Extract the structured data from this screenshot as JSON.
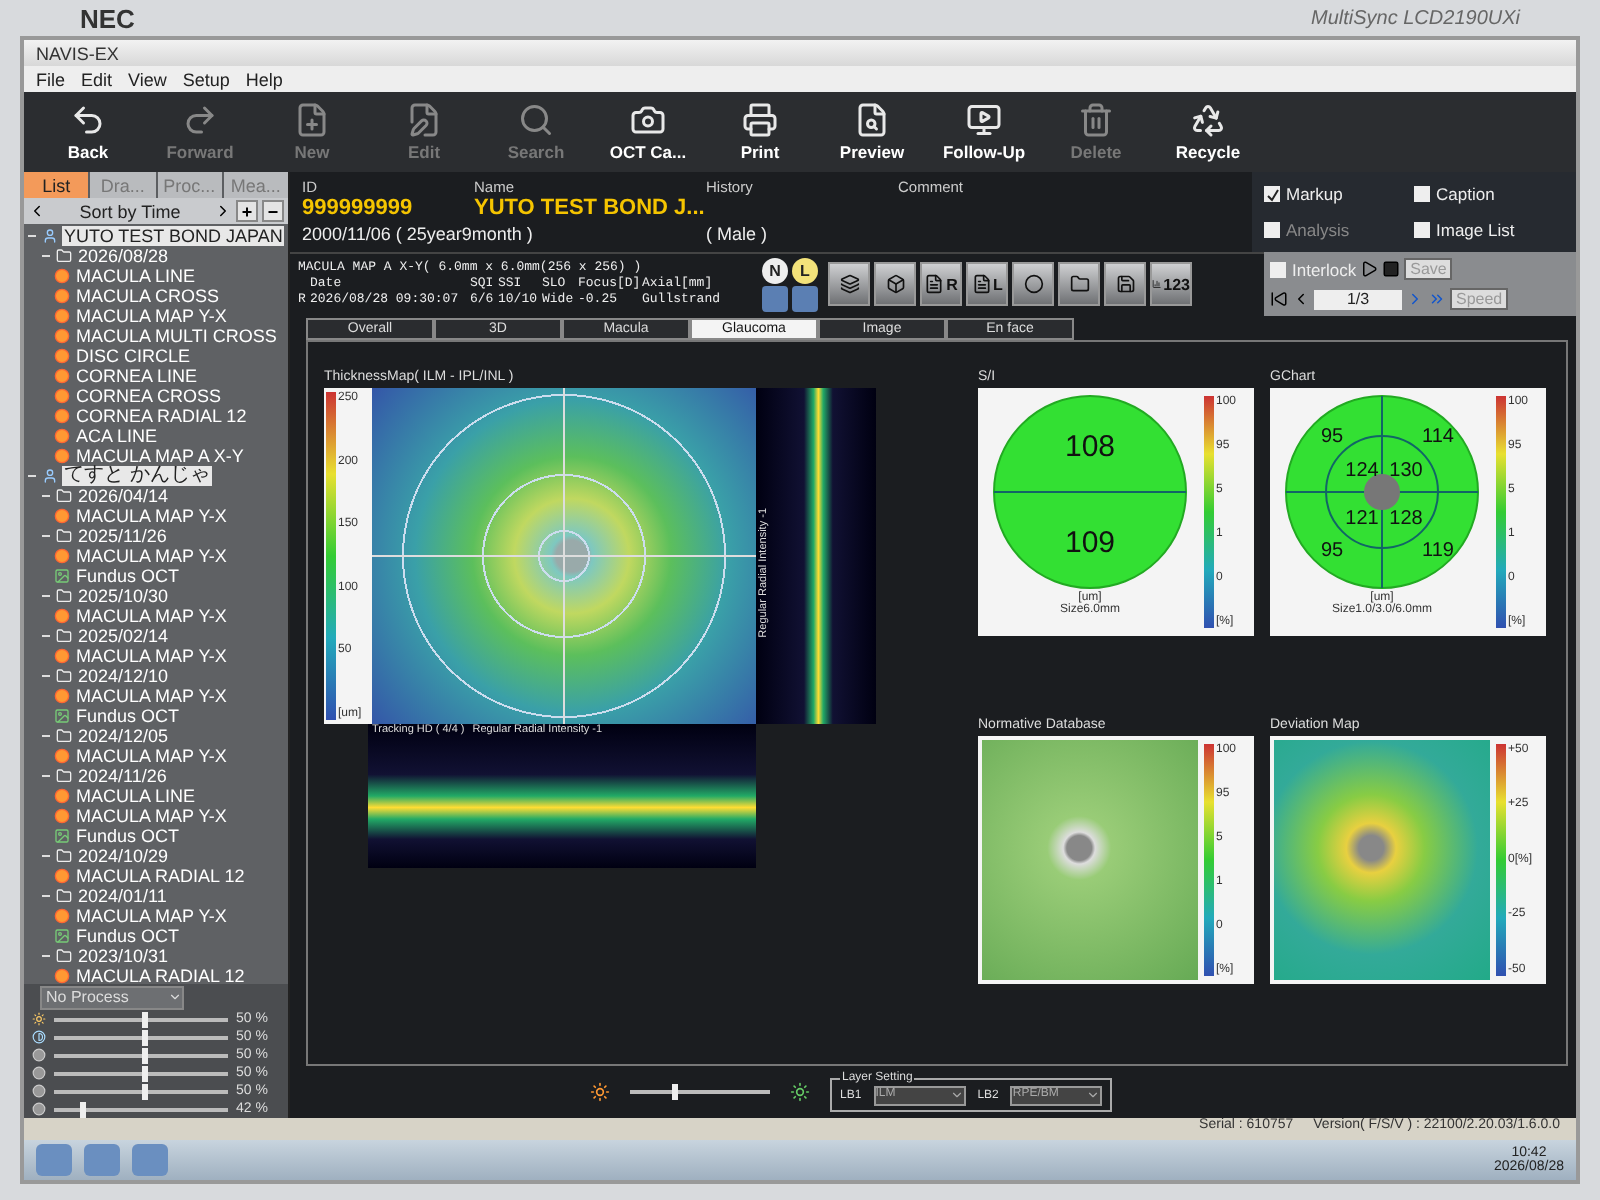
{
  "monitor": {
    "brand": "NEC",
    "model": "MultiSync LCD2190UXi"
  },
  "window": {
    "title": "NAVIS-EX"
  },
  "menu": [
    "File",
    "Edit",
    "View",
    "Setup",
    "Help"
  ],
  "toolbar": [
    {
      "label": "Back",
      "disabled": false
    },
    {
      "label": "Forward",
      "disabled": true
    },
    {
      "label": "New",
      "disabled": true
    },
    {
      "label": "Edit",
      "disabled": true
    },
    {
      "label": "Search",
      "disabled": true
    },
    {
      "label": "OCT Ca...",
      "disabled": false
    },
    {
      "label": "Print",
      "disabled": false
    },
    {
      "label": "Preview",
      "disabled": false
    },
    {
      "label": "Follow-Up",
      "disabled": false
    },
    {
      "label": "Delete",
      "disabled": true
    },
    {
      "label": "Recycle",
      "disabled": false
    }
  ],
  "view_options": [
    {
      "label": "Markup",
      "checked": true,
      "disabled": false
    },
    {
      "label": "Caption",
      "checked": false,
      "disabled": false
    },
    {
      "label": "Analysis",
      "checked": false,
      "disabled": true
    },
    {
      "label": "Image List",
      "checked": false,
      "disabled": false
    }
  ],
  "sidebar": {
    "tabs": [
      {
        "label": "List",
        "selected": true
      },
      {
        "label": "Dra...",
        "selected": false
      },
      {
        "label": "Proc...",
        "selected": false
      },
      {
        "label": "Mea...",
        "selected": false
      }
    ],
    "sort": "Sort by Time",
    "add": "+",
    "remove": "−",
    "tree": [
      {
        "label": "YUTO TEST BOND JAPAN",
        "kind": "patient",
        "children": [
          {
            "label": "2026/08/28",
            "kind": "date",
            "children": [
              {
                "label": "MACULA LINE",
                "kind": "scan"
              },
              {
                "label": "MACULA CROSS",
                "kind": "scan"
              },
              {
                "label": "MACULA MAP Y-X",
                "kind": "scan"
              },
              {
                "label": "MACULA MULTI CROSS",
                "kind": "scan"
              },
              {
                "label": "DISC CIRCLE",
                "kind": "scan"
              },
              {
                "label": "CORNEA LINE",
                "kind": "scan"
              },
              {
                "label": "CORNEA CROSS",
                "kind": "scan"
              },
              {
                "label": "CORNEA RADIAL 12",
                "kind": "scan"
              },
              {
                "label": "ACA LINE",
                "kind": "scan"
              },
              {
                "label": "MACULA MAP A X-Y",
                "kind": "scan"
              }
            ]
          }
        ]
      },
      {
        "label": "てすと かんじゃ",
        "kind": "patient",
        "children": [
          {
            "label": "2026/04/14",
            "kind": "date",
            "children": [
              {
                "label": "MACULA MAP Y-X",
                "kind": "scan"
              }
            ]
          },
          {
            "label": "2025/11/26",
            "kind": "date",
            "children": [
              {
                "label": "MACULA MAP Y-X",
                "kind": "scan"
              },
              {
                "label": "Fundus OCT",
                "kind": "fundus"
              }
            ]
          },
          {
            "label": "2025/10/30",
            "kind": "date",
            "children": [
              {
                "label": "MACULA MAP Y-X",
                "kind": "scan"
              }
            ]
          },
          {
            "label": "2025/02/14",
            "kind": "date",
            "children": [
              {
                "label": "MACULA MAP Y-X",
                "kind": "scan"
              }
            ]
          },
          {
            "label": "2024/12/10",
            "kind": "date",
            "children": [
              {
                "label": "MACULA MAP Y-X",
                "kind": "scan"
              },
              {
                "label": "Fundus OCT",
                "kind": "fundus"
              }
            ]
          },
          {
            "label": "2024/12/05",
            "kind": "date",
            "children": [
              {
                "label": "MACULA MAP Y-X",
                "kind": "scan"
              }
            ]
          },
          {
            "label": "2024/11/26",
            "kind": "date",
            "children": [
              {
                "label": "MACULA LINE",
                "kind": "scan"
              },
              {
                "label": "MACULA MAP Y-X",
                "kind": "scan"
              },
              {
                "label": "Fundus OCT",
                "kind": "fundus"
              }
            ]
          },
          {
            "label": "2024/10/29",
            "kind": "date",
            "children": [
              {
                "label": "MACULA RADIAL 12",
                "kind": "scan"
              }
            ]
          },
          {
            "label": "2024/01/11",
            "kind": "date",
            "children": [
              {
                "label": "MACULA MAP Y-X",
                "kind": "scan"
              },
              {
                "label": "Fundus OCT",
                "kind": "fundus"
              }
            ]
          },
          {
            "label": "2023/10/31",
            "kind": "date",
            "children": [
              {
                "label": "MACULA RADIAL 12",
                "kind": "scan"
              }
            ]
          }
        ]
      }
    ],
    "process": "No Process",
    "adjusters": [
      {
        "level": 0.5,
        "reading": "50 %"
      },
      {
        "level": 0.5,
        "reading": "50 %"
      },
      {
        "level": 0.5,
        "reading": "50 %"
      },
      {
        "level": 0.5,
        "reading": "50 %"
      },
      {
        "level": 0.5,
        "reading": "50 %"
      },
      {
        "level": 0.15,
        "reading": "42 %"
      }
    ]
  },
  "patient": {
    "id_label": "ID",
    "id": "999999999",
    "name_label": "Name",
    "name": "YUTO TEST BOND J...",
    "history_label": "History",
    "comment_label": "Comment",
    "birth": "2000/11/06 ( 25year9month )",
    "sex": "( Male )"
  },
  "exam": {
    "title": "MACULA MAP A X-Y( 6.0mm x 6.0mm(256 x 256) )",
    "columns": [
      "Date",
      "SQI",
      "SSI",
      "SLO",
      "Focus[D]",
      "Axial[mm]"
    ],
    "row": [
      "R",
      "2026/08/28 09:30:07",
      "6/6",
      "10/10",
      "Wide",
      "-0.25",
      "Gullstrand"
    ]
  },
  "eye_badges": [
    {
      "label": "N",
      "selected": false
    },
    {
      "label": "L",
      "selected": true
    }
  ],
  "tool_buttons": [
    {
      "kind": "layers"
    },
    {
      "kind": "cube"
    },
    {
      "kind": "page",
      "label": "R"
    },
    {
      "kind": "page",
      "label": "L"
    },
    {
      "kind": "disc"
    },
    {
      "kind": "folder"
    },
    {
      "kind": "save"
    },
    {
      "kind": "chart",
      "label": "123"
    }
  ],
  "playback": {
    "interlock": {
      "label": "Interlock",
      "checked": false
    },
    "save": "Save",
    "page": "1/3",
    "speed": "Speed"
  },
  "tabs": [
    {
      "label": "Overall",
      "selected": false
    },
    {
      "label": "3D",
      "selected": false
    },
    {
      "label": "Macula",
      "selected": false
    },
    {
      "label": "Glaucoma",
      "selected": true
    },
    {
      "label": "Image",
      "selected": false
    },
    {
      "label": "En face",
      "selected": false
    }
  ],
  "thickness_map": {
    "title": "ThicknessMap( ILM - IPL/INL )",
    "scale": [
      "250",
      "200",
      "150",
      "100",
      "50",
      "[um]"
    ]
  },
  "vertical_scan": {
    "caption": "Regular Radial Intensity -1"
  },
  "horizontal_scan": {
    "caption_1": "Tracking HD ( 4/4 )",
    "caption_2": "Regular Radial Intensity -1"
  },
  "si_chart": {
    "title": "S/I",
    "values": [
      "108",
      "109"
    ],
    "unit": "[um]",
    "size": "Size6.0mm",
    "scale": [
      "100",
      "95",
      "5",
      "1",
      "0"
    ],
    "scale_unit": "[%]"
  },
  "g_chart": {
    "title": "GChart",
    "values": [
      "95",
      "114",
      "124",
      "130",
      "121",
      "128",
      "95",
      "119"
    ],
    "unit": "[um]",
    "size": "Size1.0/3.0/6.0mm",
    "scale": [
      "100",
      "95",
      "5",
      "1",
      "0"
    ],
    "scale_unit": "[%]"
  },
  "normative": {
    "title": "Normative Database",
    "scale": [
      "100",
      "95",
      "5",
      "1",
      "0"
    ],
    "scale_unit": "[%]"
  },
  "deviation": {
    "title": "Deviation Map",
    "scale": [
      "+50",
      "+25",
      "0[%]",
      "-25",
      "-50"
    ]
  },
  "bottom": {
    "slider": {
      "level": 0.3
    },
    "layer_title": "Layer Setting",
    "lb1": "LB1",
    "lb1_value": "ILM",
    "lb2": "LB2",
    "lb2_value": "RPE/BM"
  },
  "status": {
    "serial": "Serial : 610757",
    "version": "Version( F/S/V ) : 22100/2.20.03/1.6.0.0"
  },
  "taskbar": {
    "time": "10:42",
    "date": "2026/08/28"
  }
}
